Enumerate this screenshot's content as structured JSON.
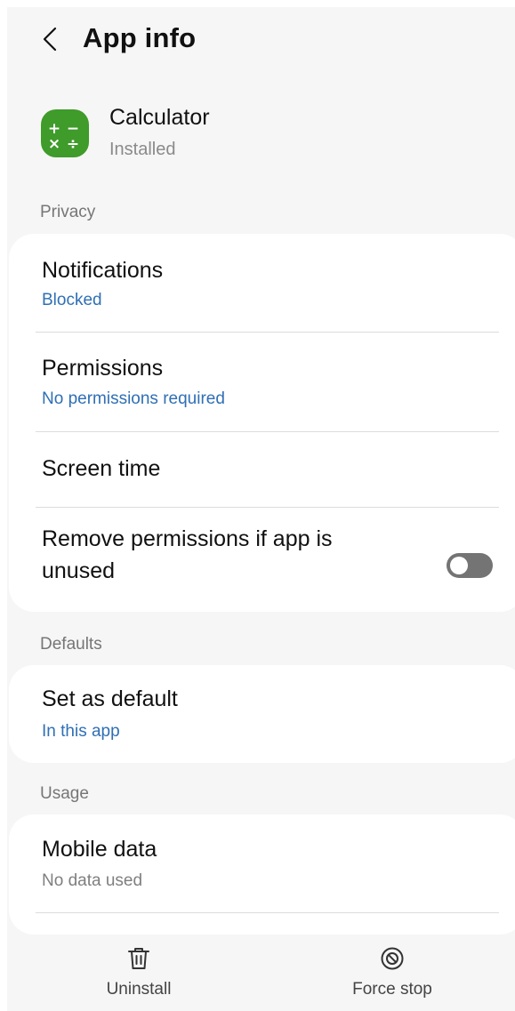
{
  "header": {
    "title": "App info",
    "back_icon": "chevron-left-icon"
  },
  "app": {
    "name": "Calculator",
    "status": "Installed",
    "icon": "calculator-app-icon",
    "icon_color": "#3f9b2a",
    "icon_symbols": [
      "+",
      "−",
      "×",
      "÷"
    ]
  },
  "sections": {
    "privacy": {
      "label": "Privacy",
      "notifications": {
        "title": "Notifications",
        "subtitle": "Blocked"
      },
      "permissions": {
        "title": "Permissions",
        "subtitle": "No permissions required"
      },
      "screen_time": {
        "title": "Screen time"
      },
      "remove_permissions": {
        "title_line1": "Remove permissions if app is",
        "title_line2": "unused",
        "enabled": false
      }
    },
    "defaults": {
      "label": "Defaults",
      "set_as_default": {
        "title": "Set as default",
        "subtitle": "In this app"
      }
    },
    "usage": {
      "label": "Usage",
      "mobile_data": {
        "title": "Mobile data",
        "subtitle": "No data used"
      }
    }
  },
  "bottom_bar": {
    "uninstall": {
      "label": "Uninstall",
      "icon": "trash-icon"
    },
    "force_stop": {
      "label": "Force stop",
      "icon": "stop-circle-icon"
    }
  },
  "colors": {
    "background": "#f6f6f6",
    "card": "#ffffff",
    "link_blue": "#2f6fb5",
    "toggle_off": "#747474"
  }
}
